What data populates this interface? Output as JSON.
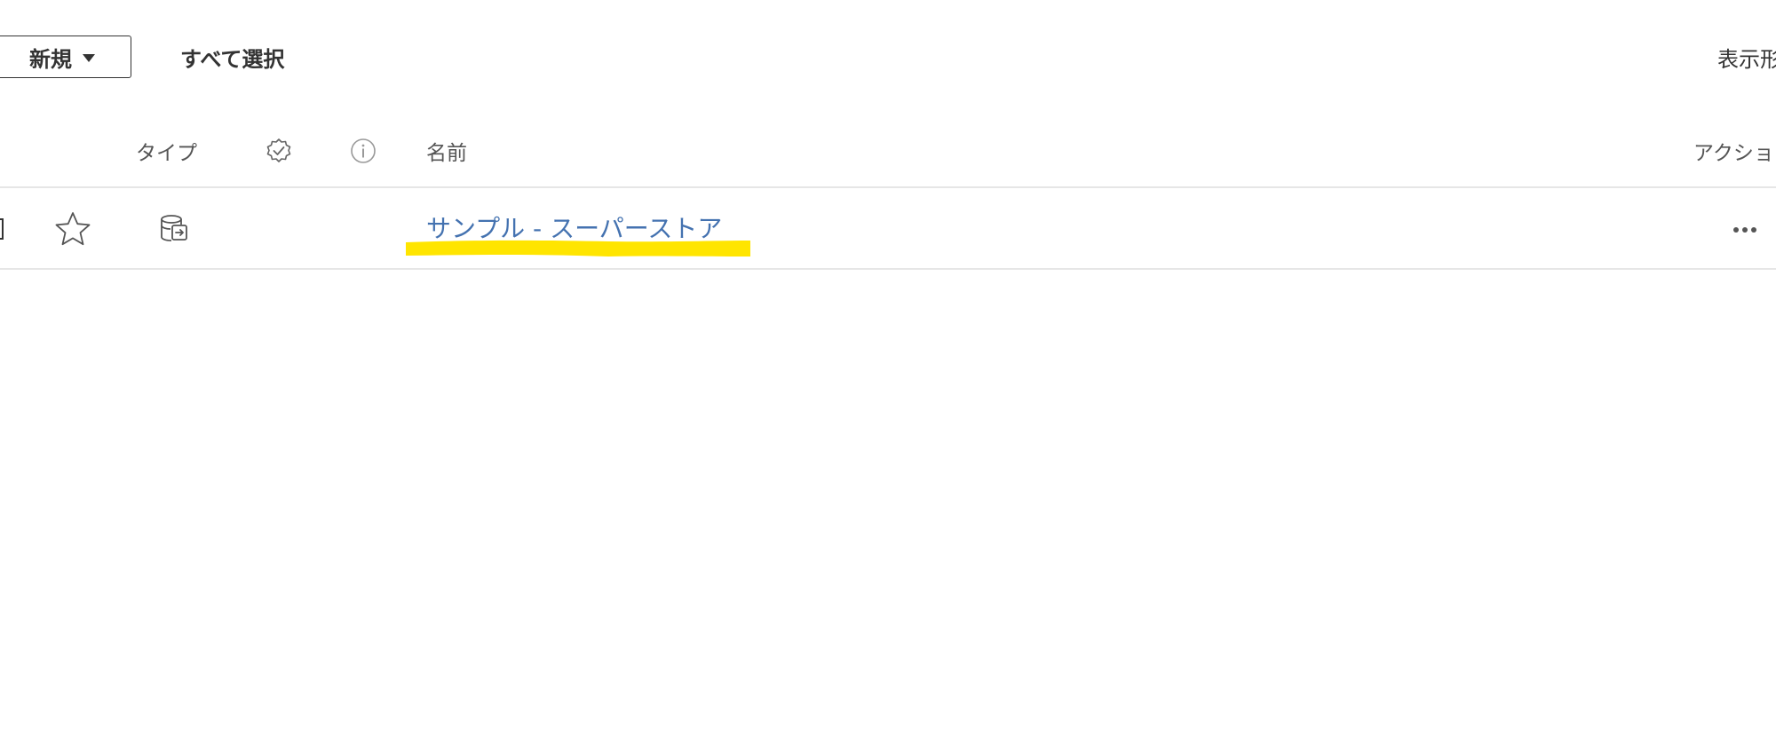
{
  "toolbar": {
    "new_label": "新規",
    "select_all_label": "すべて選択",
    "view_format_label": "表示形"
  },
  "columns": {
    "type": "タイプ",
    "name": "名前",
    "action": "アクショ"
  },
  "rows": [
    {
      "name": "サンプル - スーパーストア",
      "favorite": false,
      "type_icon": "data-source-icon"
    }
  ],
  "colors": {
    "link": "#4472b0",
    "highlight": "#ffe500",
    "divider": "#e6e6e6"
  }
}
